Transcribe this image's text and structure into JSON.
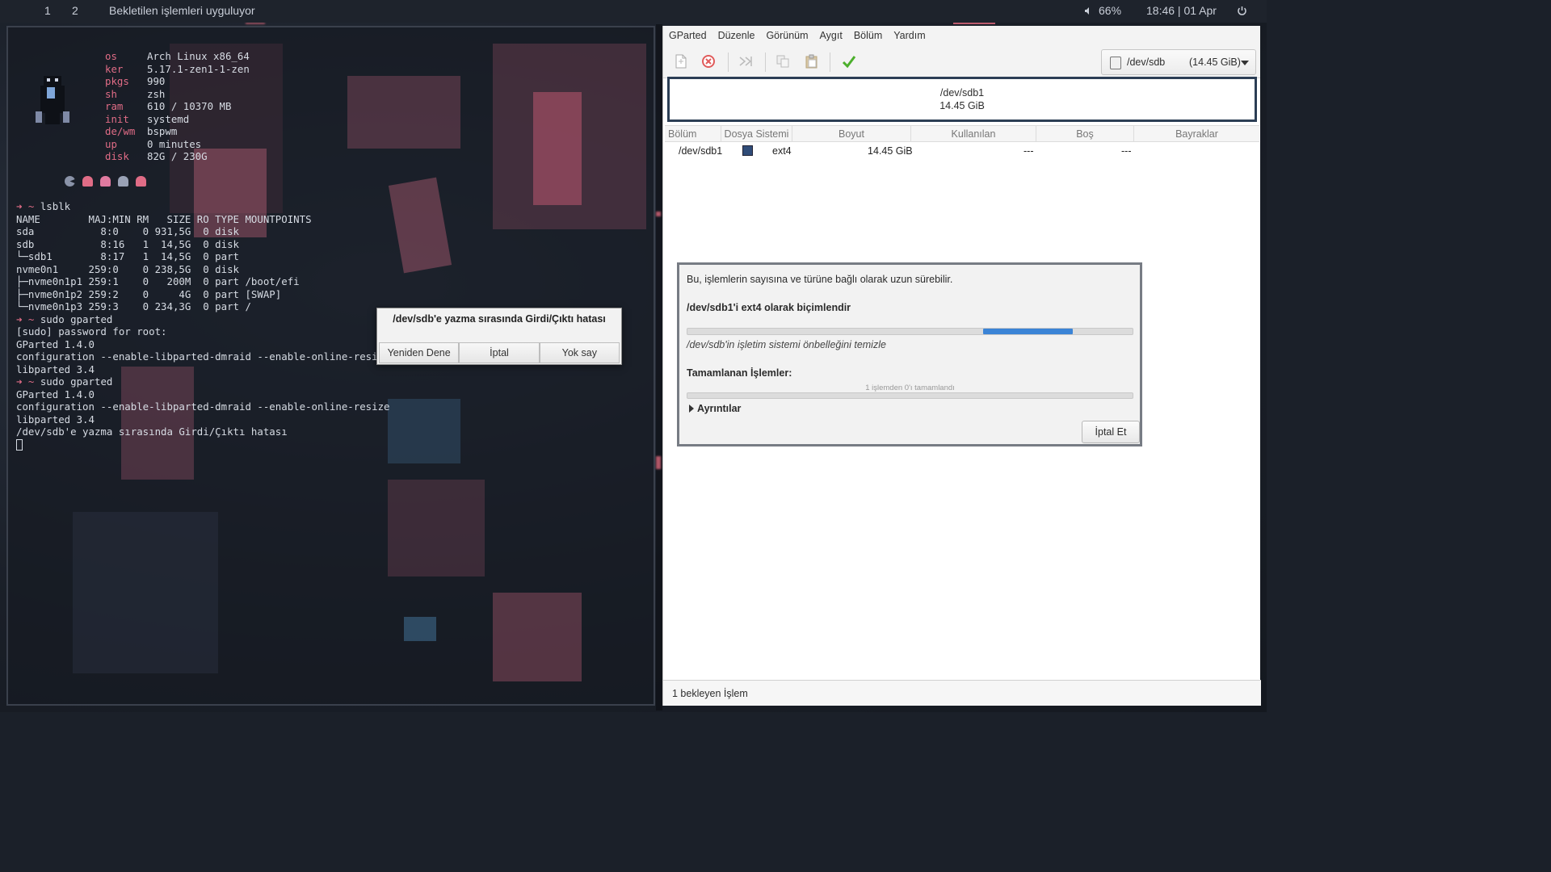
{
  "topbar": {
    "workspaces": [
      "1",
      "2"
    ],
    "window_title": "Bekletilen işlemleri uyguluyor",
    "volume": "66%",
    "clock": "18:46 | 01 Apr"
  },
  "terminal": {
    "fetch": [
      {
        "k": "os",
        "v": "Arch Linux x86_64"
      },
      {
        "k": "ker",
        "v": "5.17.1-zen1-1-zen"
      },
      {
        "k": "pkgs",
        "v": "990"
      },
      {
        "k": "sh",
        "v": "zsh"
      },
      {
        "k": "ram",
        "v": "610 / 10370 MB"
      },
      {
        "k": "init",
        "v": "systemd"
      },
      {
        "k": "de/wm",
        "v": "bspwm"
      },
      {
        "k": "up",
        "v": "0 minutes"
      },
      {
        "k": "disk",
        "v": "82G / 230G"
      }
    ],
    "prompt_symbol": "➜ ~",
    "lines": [
      {
        "type": "cmd",
        "text": "lsblk"
      },
      {
        "type": "out",
        "text": "NAME        MAJ:MIN RM   SIZE RO TYPE MOUNTPOINTS"
      },
      {
        "type": "out",
        "text": "sda           8:0    0 931,5G  0 disk"
      },
      {
        "type": "out",
        "text": "sdb           8:16   1  14,5G  0 disk"
      },
      {
        "type": "out",
        "text": "└─sdb1        8:17   1  14,5G  0 part"
      },
      {
        "type": "out",
        "text": "nvme0n1     259:0    0 238,5G  0 disk"
      },
      {
        "type": "out",
        "text": "├─nvme0n1p1 259:1    0   200M  0 part /boot/efi"
      },
      {
        "type": "out",
        "text": "├─nvme0n1p2 259:2    0     4G  0 part [SWAP]"
      },
      {
        "type": "out",
        "text": "└─nvme0n1p3 259:3    0 234,3G  0 part /"
      },
      {
        "type": "cmd",
        "text": "sudo gparted"
      },
      {
        "type": "out",
        "text": "[sudo] password for root:"
      },
      {
        "type": "out",
        "text": "GParted 1.4.0"
      },
      {
        "type": "out",
        "text": "configuration --enable-libparted-dmraid --enable-online-resiz"
      },
      {
        "type": "out",
        "text": "libparted 3.4"
      },
      {
        "type": "cmd",
        "text": "sudo gparted"
      },
      {
        "type": "out",
        "text": "GParted 1.4.0"
      },
      {
        "type": "out",
        "text": "configuration --enable-libparted-dmraid --enable-online-resize"
      },
      {
        "type": "out",
        "text": "libparted 3.4"
      },
      {
        "type": "out",
        "text": "/dev/sdb'e yazma sırasında Girdi/Çıktı hatası"
      }
    ]
  },
  "error_dialog": {
    "message": "/dev/sdb'e yazma sırasında Girdi/Çıktı hatası",
    "buttons": [
      "Yeniden Dene",
      "İptal",
      "Yok say"
    ]
  },
  "gparted": {
    "menu": [
      "GParted",
      "Düzenle",
      "Görünüm",
      "Aygıt",
      "Bölüm",
      "Yardım"
    ],
    "device": {
      "name": "/dev/sdb",
      "size": "(14.45 GiB)"
    },
    "partition_map": {
      "name": "/dev/sdb1",
      "size": "14.45 GiB"
    },
    "columns": [
      "Bölüm",
      "Dosya Sistemi",
      "Boyut",
      "Kullanılan",
      "Boş",
      "Bayraklar"
    ],
    "rows": [
      {
        "partition": "/dev/sdb1",
        "fs": "ext4",
        "size": "14.45 GiB",
        "used": "---",
        "free": "---",
        "flags": ""
      }
    ],
    "fs_color": "#304c78",
    "status": "1 bekleyen İşlem"
  },
  "progress_dialog": {
    "info": "Bu, işlemlerin sayısına ve türüne bağlı olarak uzun sürebilir.",
    "operation": "/dev/sdb1'i ext4 olarak biçimlendir",
    "progress_fraction_start": 0.665,
    "progress_fraction_end": 0.865,
    "sub_status": "/dev/sdb'in işletim sistemi önbelleğini temizle",
    "completed_label": "Tamamlanan İşlemler:",
    "completed_text": "1 işlemden 0'ı tamamlandı",
    "details_label": "Ayrıntılar",
    "cancel_label": "İptal Et",
    "accent": "#3b84d6"
  }
}
